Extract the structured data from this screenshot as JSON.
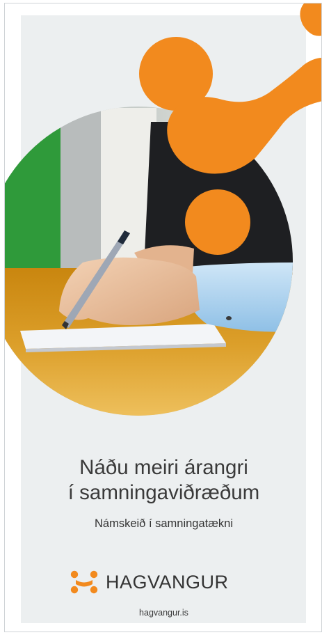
{
  "brochure": {
    "headline_line1": "Náðu meiri árangri",
    "headline_line2": "í samningaviðræðum",
    "subtitle": "Námskeið í samningatækni",
    "brand_name": "HAGVANGUR",
    "website": "hagvangur.is"
  },
  "colors": {
    "accent_orange": "#f28a1e",
    "panel_gray": "#eceff0",
    "text_dark": "#3a3a3a"
  },
  "photo": {
    "icon": "photo-hand-writing-with-pen"
  }
}
